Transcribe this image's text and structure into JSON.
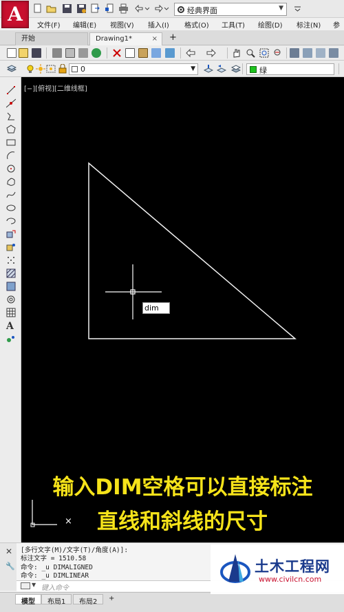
{
  "app": {
    "logo_letter": "A",
    "workspace": "经典界面"
  },
  "menu": {
    "items": [
      "文件(F)",
      "编辑(E)",
      "视图(V)",
      "插入(I)",
      "格式(O)",
      "工具(T)",
      "绘图(D)",
      "标注(N)"
    ]
  },
  "tabs": {
    "start": "开始",
    "drawing": "Drawing1*",
    "close_glyph": "×",
    "add_glyph": "+"
  },
  "layers": {
    "current_layer": "0",
    "color_name": "绿",
    "color_hex": "#1ec31e"
  },
  "canvas": {
    "viewport_label": "[−][俯视][二维线框]",
    "dynamic_input": "dim",
    "ucs_x_label": "×"
  },
  "caption": {
    "line1": "输入DIM空格可以直接标注",
    "line2": "直线和斜线的尺寸",
    "color": "#f6e31a"
  },
  "command": {
    "history": [
      "[多行文字(M)/文字(T)/角度(A)]:",
      "标注文字 = 1510.58",
      "命令: _u DIMALIGNED",
      "命令: _u DIMLINEAR"
    ],
    "prompt_placeholder": "键入命令"
  },
  "layout_tabs": [
    "模型",
    "布局1",
    "布局2",
    "+"
  ],
  "watermark": {
    "title": "土木工程网",
    "url": "www.civilcn.com"
  }
}
